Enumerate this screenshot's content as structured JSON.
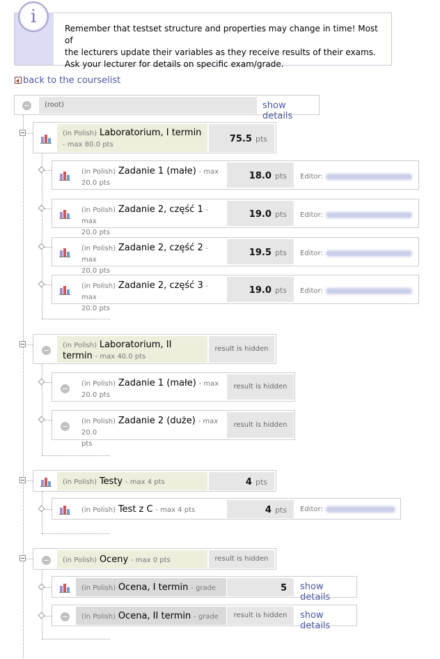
{
  "notice": {
    "icon": "info-icon",
    "line1": "Remember that testset structure and properties may change in time! Most of",
    "line2": "the lecturers update their variables as they receive results of their exams.",
    "line3": "Ask your lecturer for details on specific exam/grade."
  },
  "back_link": "back to the courselist",
  "root": {
    "label": "(root)",
    "details": "show details"
  },
  "common": {
    "prefix": "(in Polish)",
    "pts": "pts",
    "hidden": "result is hidden",
    "editor": "Editor:",
    "details": "show details"
  },
  "groups": [
    {
      "title": "Laboratorium, I termin",
      "max": "- max 80.0 pts",
      "score": "75.5",
      "icon": "chart-icon",
      "items": [
        {
          "title": "Zadanie 1 (małe)",
          "max1": "- max",
          "max2": "20.0 pts",
          "score": "18.0"
        },
        {
          "title": "Zadanie 2, część 1",
          "max1": "- max",
          "max2": "20.0 pts",
          "score": "19.0"
        },
        {
          "title": "Zadanie 2, część 2",
          "max1": "- max",
          "max2": "20.0 pts",
          "score": "19.5"
        },
        {
          "title": "Zadanie 2, część 3",
          "max1": "- max",
          "max2": "20.0 pts",
          "score": "19.0"
        }
      ]
    },
    {
      "title": "Laboratorium, II termin",
      "max": "- max 40.0 pts",
      "icon": "minus-icon",
      "items": [
        {
          "title": "Zadanie 1 (małe)",
          "max1": "- max",
          "max2": "20.0 pts"
        },
        {
          "title": "Zadanie 2 (duże)",
          "max1": "- max 20.0",
          "max2": "pts"
        }
      ]
    },
    {
      "title": "Testy",
      "max": "- max 4 pts",
      "score": "4",
      "icon": "chart-icon",
      "items": [
        {
          "title": "Test z C",
          "max1": "- max 4 pts",
          "score": "4"
        }
      ]
    },
    {
      "title": "Oceny",
      "max": "- max 0 pts",
      "icon": "minus-icon",
      "items": [
        {
          "title": "Ocena, I termin",
          "max1": "- grade",
          "score": "5"
        },
        {
          "title": "Ocena, II termin",
          "max1": "- grade"
        }
      ]
    }
  ],
  "colors": {
    "link": "#4a57a3",
    "olive": "#eeeedc",
    "grey": "#e6e6e6",
    "info_band": "#dcdcf4"
  }
}
